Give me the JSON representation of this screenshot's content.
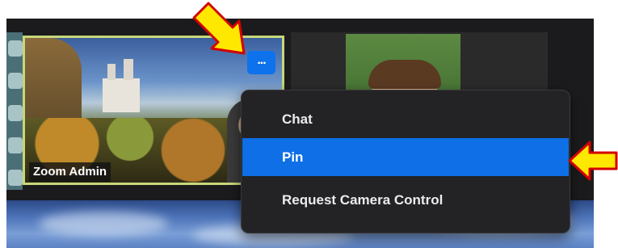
{
  "participant": {
    "name_label": "Zoom Admin"
  },
  "more_button": {
    "label": "..."
  },
  "context_menu": {
    "items": [
      {
        "label": "Chat",
        "selected": false
      },
      {
        "label": "Pin",
        "selected": true
      },
      {
        "label": "Request Camera Control",
        "selected": false
      }
    ]
  },
  "colors": {
    "menu_background": "#232325",
    "menu_highlight": "#0e6fe6",
    "more_button": "#0d72ec",
    "tile_border_active": "#c7d77a",
    "annotation_arrow_fill": "#ffe800",
    "annotation_arrow_stroke": "#d40000"
  },
  "annotations": [
    {
      "type": "arrow",
      "direction": "down-right",
      "points_to": "more-button"
    },
    {
      "type": "arrow",
      "direction": "left",
      "points_to": "menu-item-pin"
    }
  ]
}
